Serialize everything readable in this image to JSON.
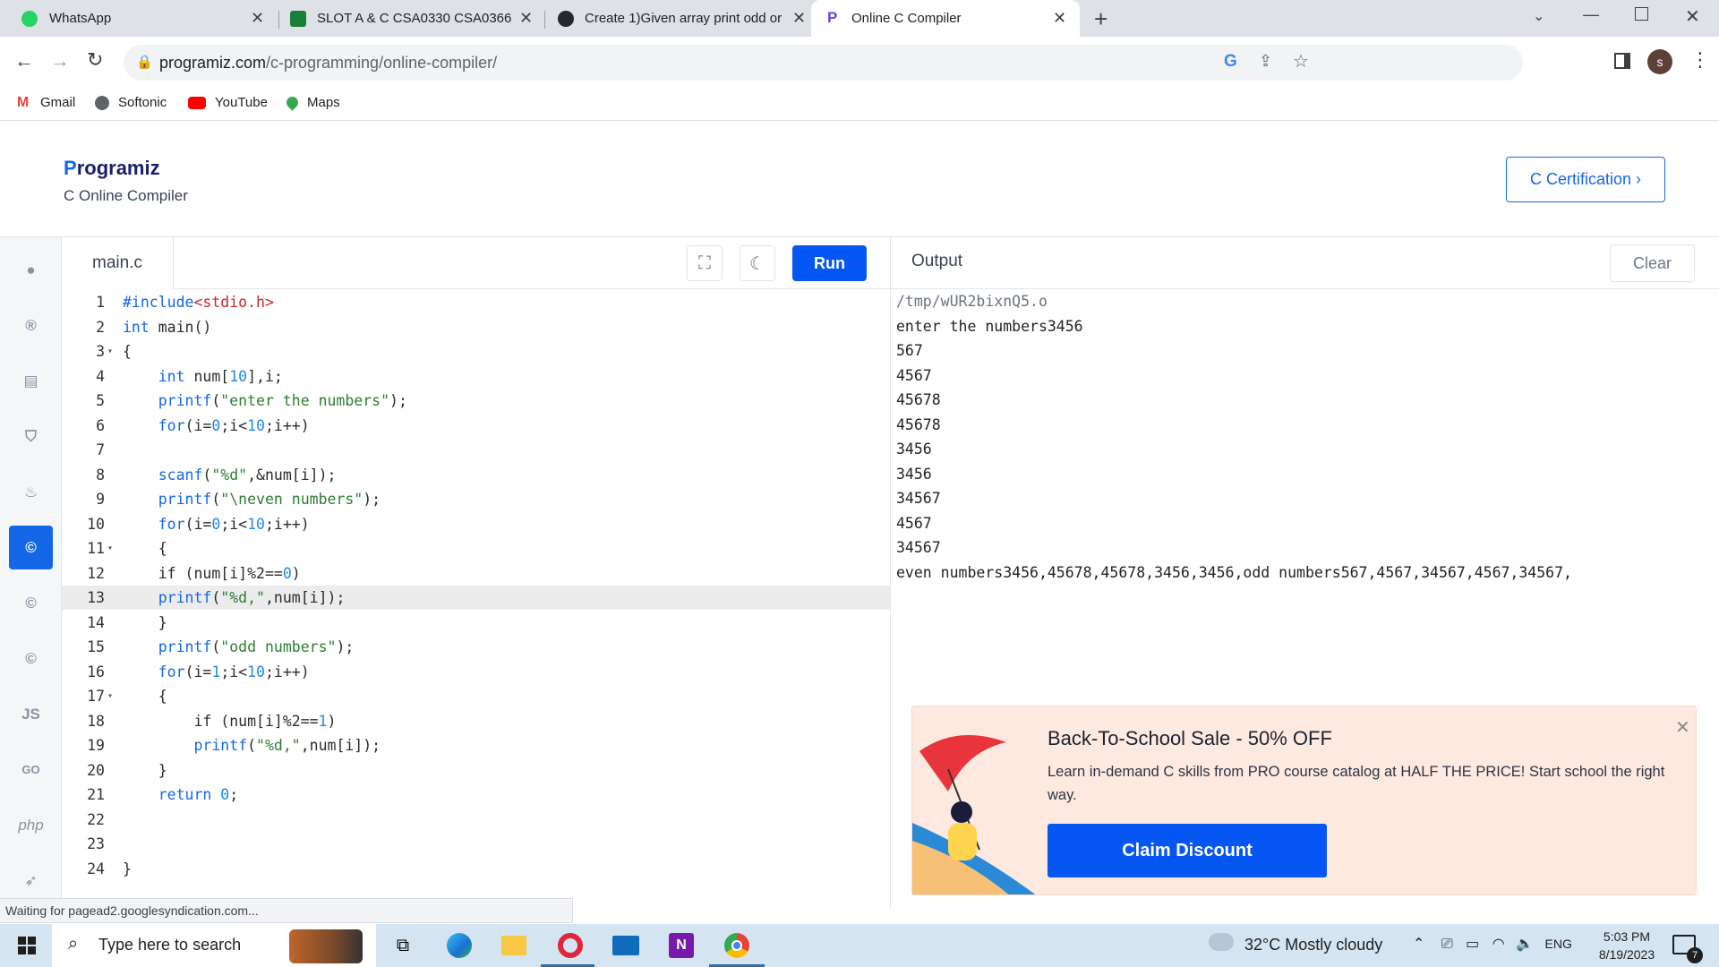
{
  "browser": {
    "tabs": [
      {
        "title": "WhatsApp",
        "active": false
      },
      {
        "title": "SLOT A & C CSA0330 CSA0366 -",
        "active": false
      },
      {
        "title": "Create 1)Given array print odd or",
        "active": false
      },
      {
        "title": "Online C Compiler",
        "active": true
      }
    ],
    "url_domain": "programiz.com",
    "url_path": "/c-programming/online-compiler/",
    "profile_initial": "s",
    "bookmarks": [
      "Gmail",
      "Softonic",
      "YouTube",
      "Maps"
    ]
  },
  "site": {
    "logo_initial": "P",
    "logo_rest": "rogramiz",
    "subtitle": "C Online Compiler",
    "cert_button": "C Certification ›"
  },
  "sidebar": {
    "languages": [
      "python",
      "r",
      "sql",
      "html",
      "java",
      "c",
      "cpp",
      "csharp",
      "JS",
      "GO",
      "php",
      "swift"
    ]
  },
  "editor": {
    "filename": "main.c",
    "run_label": "Run",
    "highlighted_line": 13,
    "lines": [
      {
        "n": "1",
        "fold": "",
        "text": "#include<stdio.h>"
      },
      {
        "n": "2",
        "fold": "",
        "text": "int main()"
      },
      {
        "n": "3",
        "fold": "▾",
        "text": "{"
      },
      {
        "n": "4",
        "fold": "",
        "text": "    int num[10],i;"
      },
      {
        "n": "5",
        "fold": "",
        "text": "    printf(\"enter the numbers\");"
      },
      {
        "n": "6",
        "fold": "",
        "text": "    for(i=0;i<10;i++)"
      },
      {
        "n": "7",
        "fold": "",
        "text": ""
      },
      {
        "n": "8",
        "fold": "",
        "text": "    scanf(\"%d\",&num[i]);"
      },
      {
        "n": "9",
        "fold": "",
        "text": "    printf(\"\\neven numbers\");"
      },
      {
        "n": "10",
        "fold": "",
        "text": "    for(i=0;i<10;i++)"
      },
      {
        "n": "11",
        "fold": "▾",
        "text": "    {"
      },
      {
        "n": "12",
        "fold": "",
        "text": "    if (num[i]%2==0)"
      },
      {
        "n": "13",
        "fold": "",
        "text": "    printf(\"%d,\",num[i]);"
      },
      {
        "n": "14",
        "fold": "",
        "text": "    }"
      },
      {
        "n": "15",
        "fold": "",
        "text": "    printf(\"odd numbers\");"
      },
      {
        "n": "16",
        "fold": "",
        "text": "    for(i=1;i<10;i++)"
      },
      {
        "n": "17",
        "fold": "▾",
        "text": "    {"
      },
      {
        "n": "18",
        "fold": "",
        "text": "        if (num[i]%2==1)"
      },
      {
        "n": "19",
        "fold": "",
        "text": "        printf(\"%d,\",num[i]);"
      },
      {
        "n": "20",
        "fold": "",
        "text": "    }"
      },
      {
        "n": "21",
        "fold": "",
        "text": "    return 0;"
      },
      {
        "n": "22",
        "fold": "",
        "text": ""
      },
      {
        "n": "23",
        "fold": "",
        "text": ""
      },
      {
        "n": "24",
        "fold": "",
        "text": "}"
      }
    ]
  },
  "output": {
    "label": "Output",
    "clear_label": "Clear",
    "lines": [
      "/tmp/wUR2bixnQ5.o",
      "enter the numbers3456",
      "567",
      "4567",
      "45678",
      "45678",
      "3456",
      "3456",
      "34567",
      "4567",
      "34567",
      "even numbers3456,45678,45678,3456,3456,odd numbers567,4567,34567,4567,34567,"
    ]
  },
  "promo": {
    "title": "Back-To-School Sale - 50% OFF",
    "description": "Learn in-demand C skills from PRO course catalog at HALF THE PRICE! Start school the right way.",
    "button": "Claim Discount"
  },
  "status_text": "Waiting for pagead2.googlesyndication.com...",
  "taskbar": {
    "search_placeholder": "Type here to search",
    "weather": "32°C  Mostly cloudy",
    "language": "ENG",
    "time": "5:03 PM",
    "date": "8/19/2023",
    "notification_count": "7"
  }
}
